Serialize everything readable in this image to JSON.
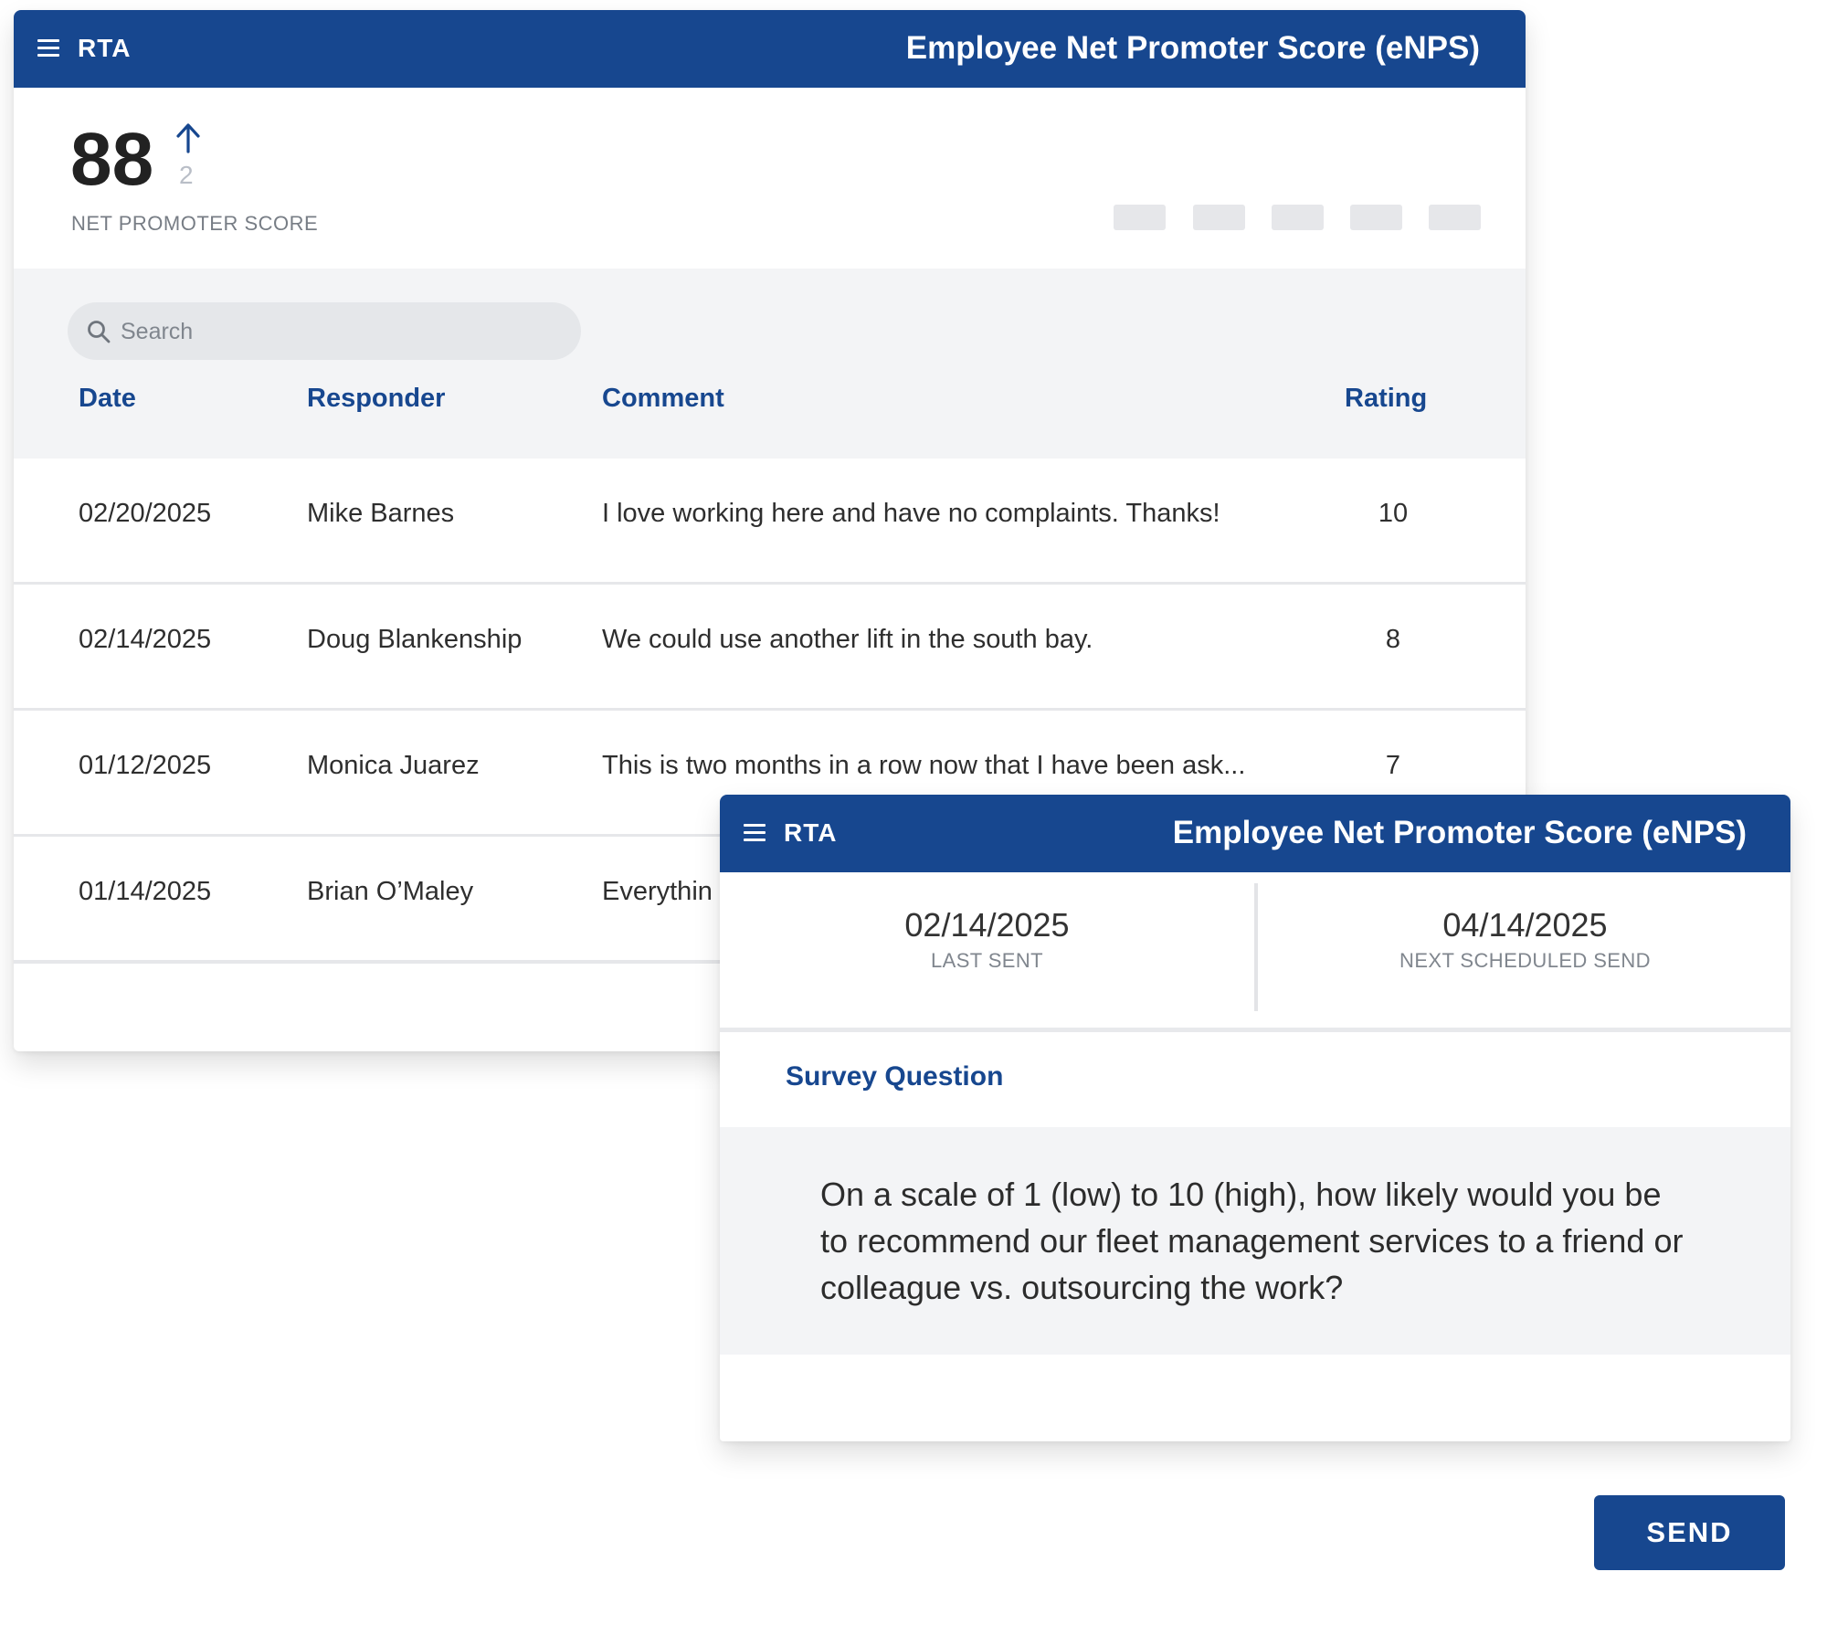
{
  "main_window": {
    "logo": "RTA",
    "title": "Employee Net Promoter Score (eNPS)",
    "score": {
      "value": "88",
      "trend": "up",
      "delta": "2",
      "label": "NET PROMOTER SCORE"
    },
    "search": {
      "placeholder": "Search"
    },
    "columns": {
      "date": "Date",
      "responder": "Responder",
      "comment": "Comment",
      "rating": "Rating"
    },
    "rows": [
      {
        "date": "02/20/2025",
        "responder": "Mike Barnes",
        "comment": "I love working here and have no complaints. Thanks!",
        "rating": "10"
      },
      {
        "date": "02/14/2025",
        "responder": "Doug Blankenship",
        "comment": "We could use another lift in the south bay.",
        "rating": "8"
      },
      {
        "date": "01/12/2025",
        "responder": "Monica Juarez",
        "comment": "This is two months in a row now that I have been ask...",
        "rating": "7"
      },
      {
        "date": "01/14/2025",
        "responder": "Brian O’Maley",
        "comment": "Everythin",
        "rating": ""
      }
    ]
  },
  "survey_window": {
    "logo": "RTA",
    "title": "Employee Net Promoter Score (eNPS)",
    "last_sent": {
      "value": "02/14/2025",
      "label": "LAST SENT"
    },
    "next_send": {
      "value": "04/14/2025",
      "label": "NEXT SCHEDULED SEND"
    },
    "question_heading": "Survey Question",
    "question_text": "On a scale of 1 (low) to 10 (high), how likely would you be to recommend our fleet management services to a friend or colleague vs. outsourcing the work?"
  },
  "send_label": "SEND",
  "colors": {
    "brand_blue": "#17478f",
    "band_gray": "#f3f4f6"
  },
  "icons": {
    "menu": "hamburger-icon",
    "trend": "arrow-up-icon",
    "search": "search-icon"
  }
}
